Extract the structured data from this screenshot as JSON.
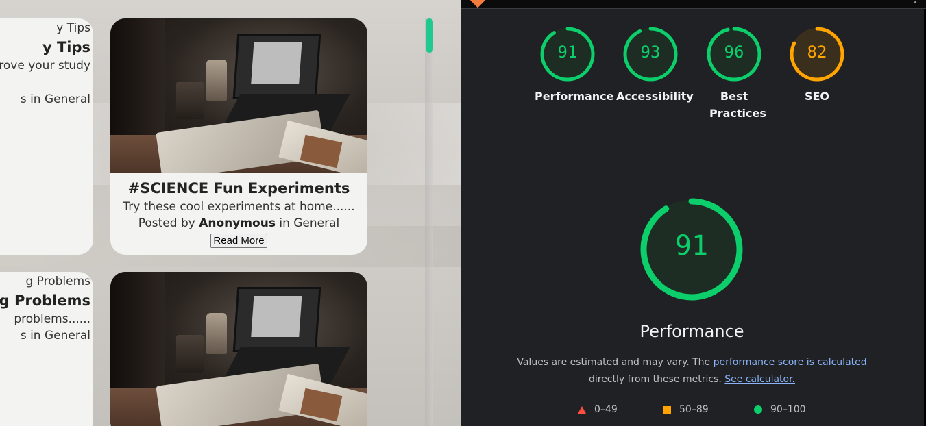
{
  "blog": {
    "cards_left": [
      {
        "tag": "y Tips",
        "title": "y Tips",
        "desc": "rove your study",
        "posted": "s in General"
      },
      {
        "tag": "g Problems",
        "title": "g Problems",
        "desc": "problems......",
        "posted": "s in General"
      }
    ],
    "card_main": {
      "title": "#SCIENCE Fun Experiments",
      "desc": "Try these cool experiments at home......",
      "posted_prefix": "Posted by",
      "author": "Anonymous",
      "posted_suffix": "in General",
      "read_more": "Read More"
    }
  },
  "lighthouse": {
    "scores": [
      {
        "value": "91",
        "label": "Performance",
        "status": "pass",
        "color": "#0cce6b"
      },
      {
        "value": "93",
        "label": "Accessibility",
        "status": "pass",
        "color": "#0cce6b"
      },
      {
        "value": "96",
        "label": "Best Practices",
        "status": "pass",
        "color": "#0cce6b"
      },
      {
        "value": "82",
        "label": "SEO",
        "status": "average",
        "color": "#ffa400"
      }
    ],
    "main_score": {
      "value": "91",
      "label": "Performance",
      "color": "#0cce6b"
    },
    "note_text_1": "Values are estimated and may vary. The",
    "note_link_1": "performance score is calculated",
    "note_text_2": "directly from these metrics.",
    "note_link_2": "See calculator.",
    "legend": [
      {
        "range": "0–49",
        "icon": "triangle-icon",
        "color": "#ff4e42"
      },
      {
        "range": "50–89",
        "icon": "square-icon",
        "color": "#ffa400"
      },
      {
        "range": "90–100",
        "icon": "circle-icon",
        "color": "#0cce6b"
      }
    ]
  }
}
